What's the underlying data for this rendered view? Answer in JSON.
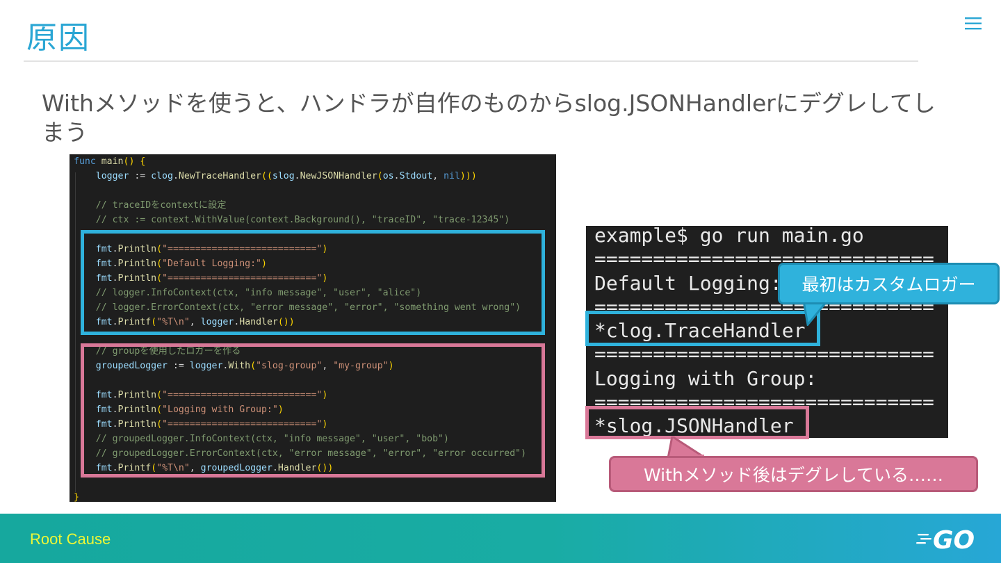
{
  "slide": {
    "title": "原因",
    "headline": "Withメソッドを使うと、ハンドラが自作のものからslog.JSONHandlerにデグレしてしまう"
  },
  "code": {
    "lines": [
      "func main() {",
      "    logger := clog.NewTraceHandler((slog.NewJSONHandler(os.Stdout, nil)))",
      "",
      "    // traceIDをcontextに設定",
      "    // ctx := context.WithValue(context.Background(), \"traceID\", \"trace-12345\")",
      "",
      "    fmt.Println(\"===========================\")",
      "    fmt.Println(\"Default Logging:\")",
      "    fmt.Println(\"===========================\")",
      "    // logger.InfoContext(ctx, \"info message\", \"user\", \"alice\")",
      "    // logger.ErrorContext(ctx, \"error message\", \"error\", \"something went wrong\")",
      "    fmt.Printf(\"%T\\n\", logger.Handler())",
      "",
      "    // groupを使用したロガーを作る",
      "    groupedLogger := logger.With(\"slog-group\", \"my-group\")",
      "",
      "    fmt.Println(\"===========================\")",
      "    fmt.Println(\"Logging with Group:\")",
      "    fmt.Println(\"===========================\")",
      "    // groupedLogger.InfoContext(ctx, \"info message\", \"user\", \"bob\")",
      "    // groupedLogger.ErrorContext(ctx, \"error message\", \"error\", \"error occurred\")",
      "    fmt.Printf(\"%T\\n\", groupedLogger.Handler())",
      "",
      "}"
    ]
  },
  "terminal": {
    "lines": [
      "example$ go run main.go",
      "=============================",
      "Default Logging:",
      "=============================",
      "*clog.TraceHandler",
      "=============================",
      "Logging with Group:",
      "=============================",
      "*slog.JSONHandler"
    ]
  },
  "callouts": {
    "blue": "最初はカスタムロガー",
    "pink": "Withメソッド後はデグレしている……"
  },
  "footer": {
    "label": "Root Cause",
    "logo": "GO"
  },
  "colors": {
    "accent_blue": "#2fb2dc",
    "accent_pink": "#d97898",
    "title": "#2aa6d4",
    "footer_label": "#eef736"
  },
  "icons": {
    "menu": "hamburger-menu-icon",
    "logo": "go-gopher-logo"
  }
}
